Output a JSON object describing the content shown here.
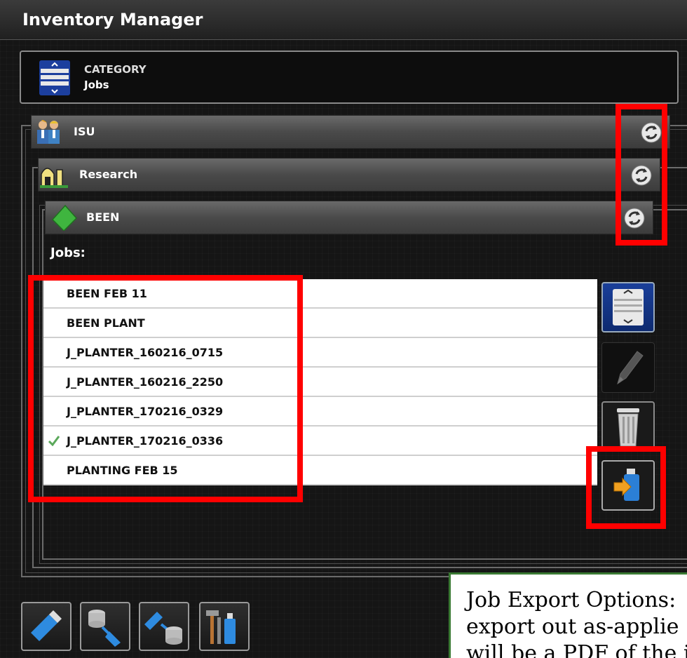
{
  "app": {
    "title": "Inventory Manager"
  },
  "category": {
    "label": "CATEGORY",
    "value": "Jobs",
    "icon": "category-scroll-icon"
  },
  "hierarchy": {
    "client": {
      "label": "ISU",
      "icon": "people-icon"
    },
    "farm": {
      "label": "Research",
      "icon": "farm-barn-icon"
    },
    "field": {
      "label": "BEEN",
      "icon": "field-icon"
    }
  },
  "jobs": {
    "label": "Jobs:",
    "items": [
      {
        "name": "BEEN FEB 11",
        "checked": false
      },
      {
        "name": "BEEN PLANT",
        "checked": false
      },
      {
        "name": "J_PLANTER_160216_0715",
        "checked": false
      },
      {
        "name": "J_PLANTER_160216_2250",
        "checked": false
      },
      {
        "name": "J_PLANTER_170216_0329",
        "checked": false
      },
      {
        "name": "J_PLANTER_170216_0336",
        "checked": true
      },
      {
        "name": "PLANTING FEB 15",
        "checked": false
      }
    ]
  },
  "side_buttons": [
    "scroll-list-icon",
    "edit-pencil-icon",
    "trash-icon",
    "usb-export-icon"
  ],
  "bottom_buttons": [
    "usb-icon",
    "data-to-usb-icon",
    "usb-to-data-icon",
    "tools-usb-icon"
  ],
  "note": {
    "text": "Job Export Options: \nexport out as-applie\nwill be a PDF of the i"
  },
  "colors": {
    "highlight": "#ff0000",
    "note_border": "#3a7a33",
    "check": "#4caf50"
  }
}
